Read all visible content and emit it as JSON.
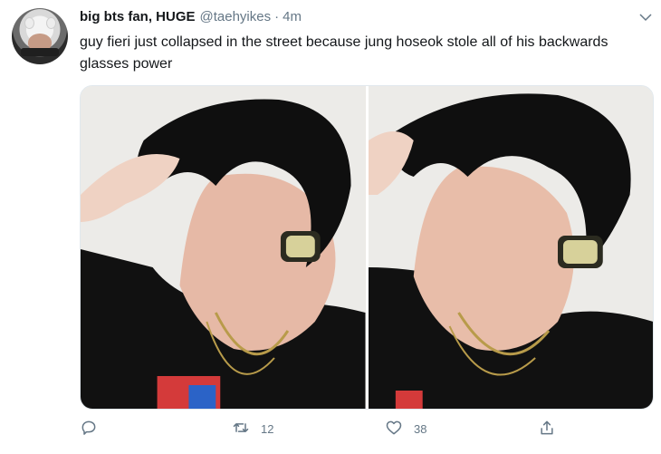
{
  "tweet": {
    "display_name": "big bts fan, HUGE",
    "handle": "@taehyikes",
    "separator": "·",
    "time": "4m",
    "text": "guy fieri just collapsed in the street because jung hoseok stole all of his backwards glasses power",
    "media_count": 2
  },
  "actions": {
    "reply": {
      "icon": "reply-icon",
      "count": ""
    },
    "retweet": {
      "icon": "retweet-icon",
      "count": "12"
    },
    "like": {
      "icon": "heart-icon",
      "count": "38"
    },
    "share": {
      "icon": "share-icon"
    }
  },
  "colors": {
    "text": "#14171a",
    "secondary": "#657786",
    "border": "#e1e8ed"
  }
}
